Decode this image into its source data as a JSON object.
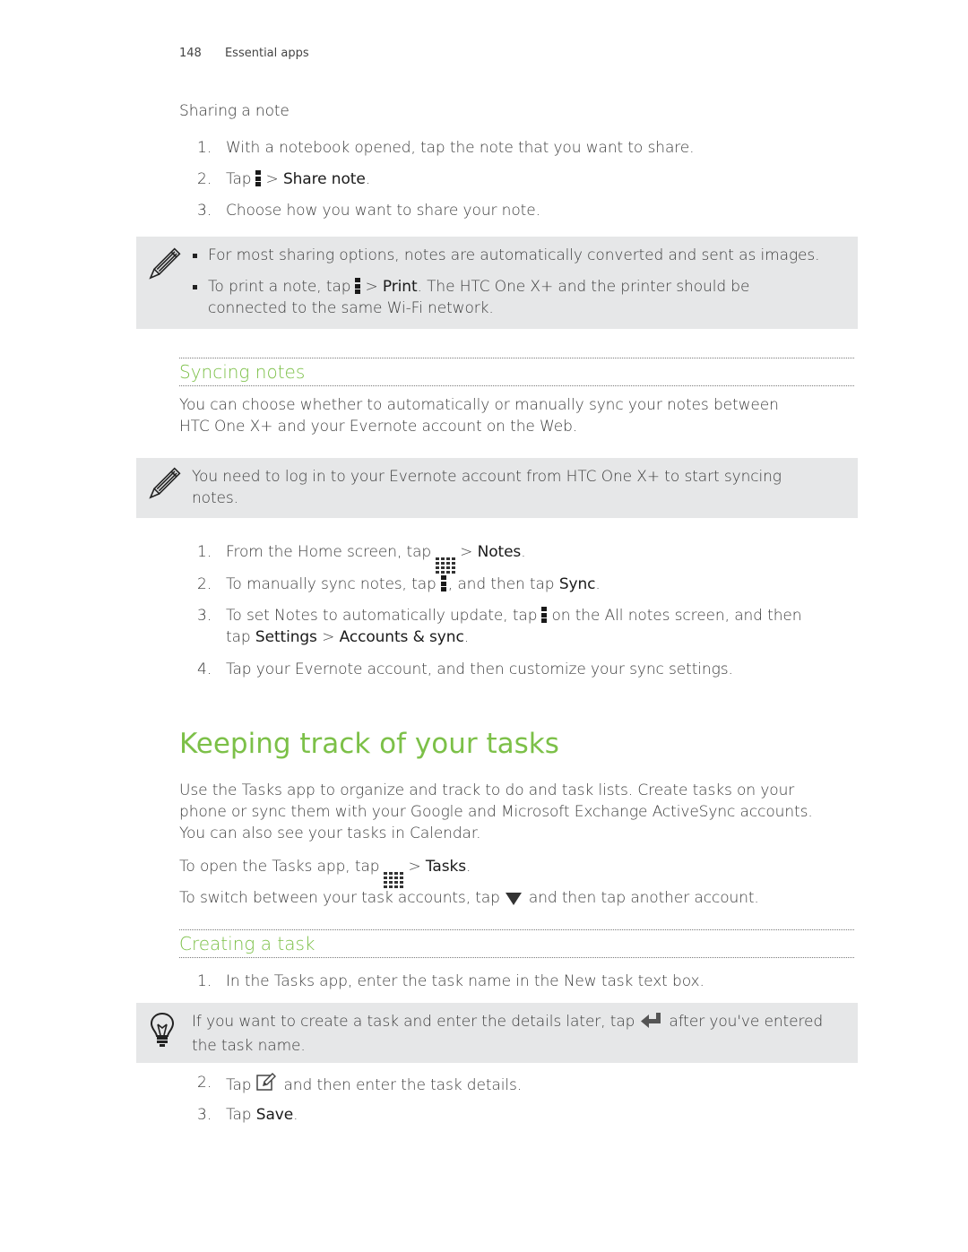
{
  "header": {
    "page_number": "148",
    "section": "Essential apps"
  },
  "sharing": {
    "title": "Sharing a note",
    "steps": [
      {
        "n": "1.",
        "text": "With a notebook opened, tap the note that you want to share."
      },
      {
        "n": "2.",
        "pre": "Tap",
        "post": "> ",
        "bold": "Share note",
        "end": "."
      },
      {
        "n": "3.",
        "text": "Choose how you want to share your note."
      }
    ],
    "note": {
      "bullet1": "For most sharing options, notes are automatically converted and sent as images.",
      "bullet2_pre": "To print a note, tap",
      "bullet2_gt": "> ",
      "bullet2_bold": "Print",
      "bullet2_post": ". The HTC One X+ and the printer should be",
      "bullet2_line2": "connected to the same Wi-Fi network."
    }
  },
  "syncing": {
    "heading": "Syncing notes",
    "intro_line1": "You can choose whether to automatically or manually sync your notes between",
    "intro_line2": "HTC One X+ and your Evernote account on the Web.",
    "note_line1": "You need to log in to your Evernote account from HTC One X+ to start syncing",
    "note_line2": "notes.",
    "steps": [
      {
        "n": "1.",
        "pre": "From the Home screen, tap",
        "gt": "> ",
        "bold": "Notes",
        "end": "."
      },
      {
        "n": "2.",
        "pre": "To manually sync notes, tap",
        "mid": ", and then tap ",
        "bold": "Sync",
        "end": "."
      },
      {
        "n": "3.",
        "pre": "To set Notes to automatically update, tap",
        "post": "on the All notes screen, and then",
        "line2_pre": "tap ",
        "bold1": "Settings",
        "gt": " > ",
        "bold2": "Accounts & sync",
        "end": "."
      },
      {
        "n": "4.",
        "text": "Tap your Evernote account, and then customize your sync settings."
      }
    ]
  },
  "tasks": {
    "heading": "Keeping track of your tasks",
    "intro_line1": "Use the Tasks app to organize and track to do and task lists. Create tasks on your",
    "intro_line2": "phone or sync them with your Google and Microsoft Exchange ActiveSync accounts.",
    "intro_line3": "You can also see your tasks in Calendar.",
    "open_pre": "To open the Tasks app, tap",
    "open_gt": "> ",
    "open_bold": "Tasks",
    "open_end": ".",
    "switch_pre": "To switch between your task accounts, tap",
    "switch_post": "and then tap another account."
  },
  "creating": {
    "heading": "Creating a task",
    "step1": {
      "n": "1.",
      "text": "In the Tasks app, enter the task name in the New task text box."
    },
    "tip_pre": "If you want to create a task and enter the details later, tap",
    "tip_post": "after you've entered",
    "tip_line2": "the task name.",
    "step2": {
      "n": "2.",
      "pre": "Tap",
      "post": "and then enter the task details."
    },
    "step3": {
      "n": "3.",
      "pre": "Tap ",
      "bold": "Save",
      "end": "."
    }
  },
  "colors": {
    "accent_green": "#7cc048",
    "note_bg": "#e6e7e8"
  }
}
